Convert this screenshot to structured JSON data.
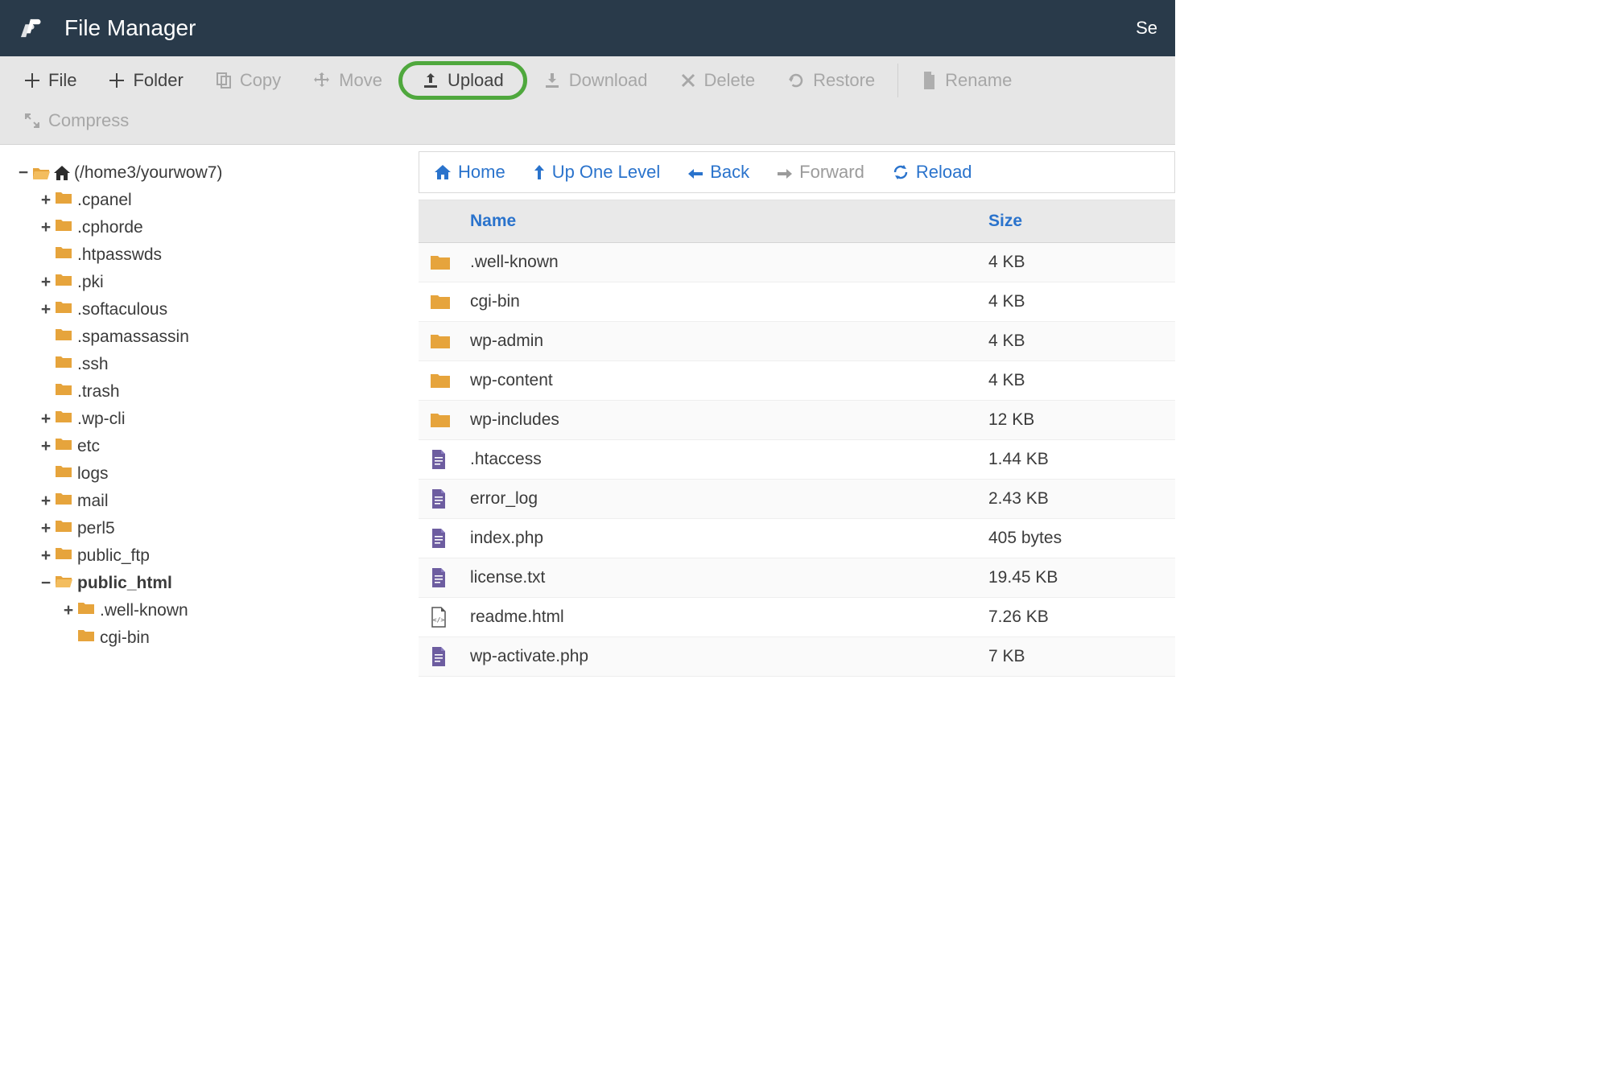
{
  "header": {
    "title": "File Manager",
    "right": "Se"
  },
  "toolbar": {
    "file": {
      "label": "File",
      "enabled": true
    },
    "folder": {
      "label": "Folder",
      "enabled": true
    },
    "copy": {
      "label": "Copy",
      "enabled": false
    },
    "move": {
      "label": "Move",
      "enabled": false
    },
    "upload": {
      "label": "Upload",
      "enabled": true,
      "highlighted": true
    },
    "download": {
      "label": "Download",
      "enabled": false
    },
    "delete": {
      "label": "Delete",
      "enabled": false
    },
    "restore": {
      "label": "Restore",
      "enabled": false
    },
    "rename": {
      "label": "Rename",
      "enabled": false
    },
    "compress": {
      "label": "Compress",
      "enabled": false
    }
  },
  "tree": {
    "root_label": "(/home3/yourwow7)",
    "items": [
      {
        "label": ".cpanel",
        "expandable": true
      },
      {
        "label": ".cphorde",
        "expandable": true
      },
      {
        "label": ".htpasswds",
        "expandable": false
      },
      {
        "label": ".pki",
        "expandable": true
      },
      {
        "label": ".softaculous",
        "expandable": true
      },
      {
        "label": ".spamassassin",
        "expandable": false
      },
      {
        "label": ".ssh",
        "expandable": false
      },
      {
        "label": ".trash",
        "expandable": false
      },
      {
        "label": ".wp-cli",
        "expandable": true
      },
      {
        "label": "etc",
        "expandable": true
      },
      {
        "label": "logs",
        "expandable": false
      },
      {
        "label": "mail",
        "expandable": true
      },
      {
        "label": "perl5",
        "expandable": true
      },
      {
        "label": "public_ftp",
        "expandable": true
      },
      {
        "label": "public_html",
        "expandable": true,
        "expanded": true,
        "current": true,
        "children": [
          {
            "label": ".well-known",
            "expandable": true
          },
          {
            "label": "cgi-bin",
            "expandable": false
          }
        ]
      }
    ]
  },
  "nav": {
    "home": "Home",
    "up": "Up One Level",
    "back": "Back",
    "forward": "Forward",
    "reload": "Reload"
  },
  "table": {
    "headers": {
      "name": "Name",
      "size": "Size"
    },
    "rows": [
      {
        "icon": "folder",
        "name": ".well-known",
        "size": "4 KB"
      },
      {
        "icon": "folder",
        "name": "cgi-bin",
        "size": "4 KB"
      },
      {
        "icon": "folder",
        "name": "wp-admin",
        "size": "4 KB"
      },
      {
        "icon": "folder",
        "name": "wp-content",
        "size": "4 KB"
      },
      {
        "icon": "folder",
        "name": "wp-includes",
        "size": "12 KB"
      },
      {
        "icon": "fileA",
        "name": ".htaccess",
        "size": "1.44 KB"
      },
      {
        "icon": "fileA",
        "name": "error_log",
        "size": "2.43 KB"
      },
      {
        "icon": "fileB",
        "name": "index.php",
        "size": "405 bytes"
      },
      {
        "icon": "fileB",
        "name": "license.txt",
        "size": "19.45 KB"
      },
      {
        "icon": "html",
        "name": "readme.html",
        "size": "7.26 KB"
      },
      {
        "icon": "fileB",
        "name": "wp-activate.php",
        "size": "7 KB"
      }
    ]
  }
}
